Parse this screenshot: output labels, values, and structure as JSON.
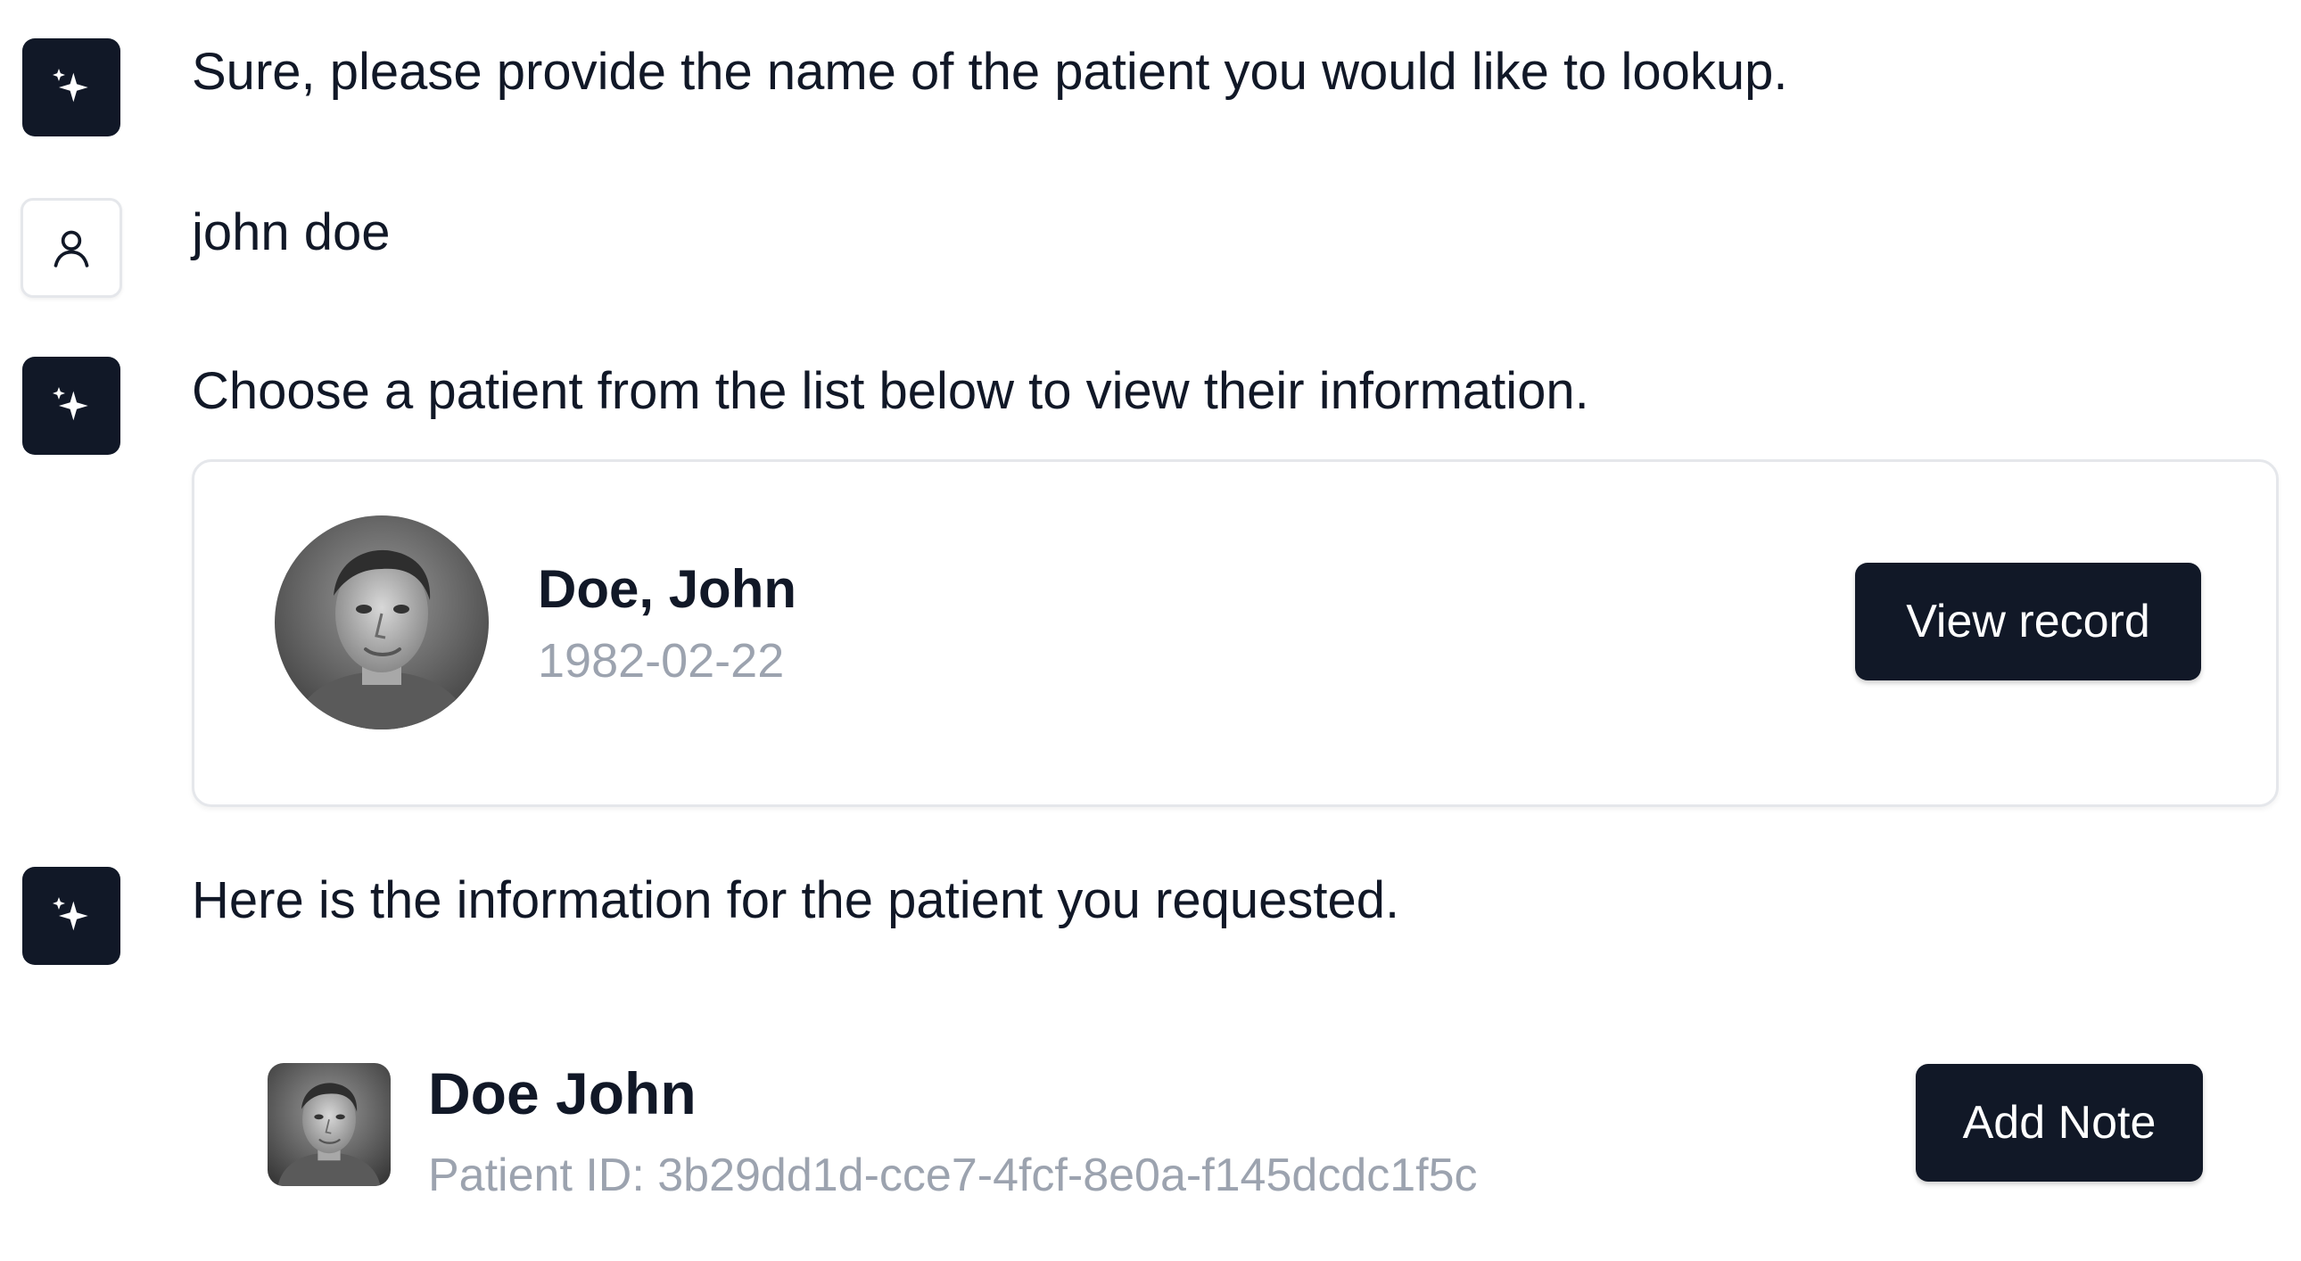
{
  "messages": [
    {
      "role": "assistant",
      "icon": "sparkles-icon",
      "text": "Sure, please provide the name of the patient you would like to lookup."
    },
    {
      "role": "user",
      "icon": "user-icon",
      "text": "john doe"
    },
    {
      "role": "assistant",
      "icon": "sparkles-icon",
      "text": "Choose a patient from the list below to view their information."
    },
    {
      "role": "assistant",
      "icon": "sparkles-icon",
      "text": "Here is the information for the patient you requested."
    }
  ],
  "patient_list": {
    "patients": [
      {
        "name": "Doe, John",
        "dob": "1982-02-22",
        "action_label": "View record"
      }
    ]
  },
  "patient_info": {
    "name": "Doe John",
    "patient_id": "Patient ID: 3b29dd1d-cce7-4fcf-8e0a-f145dcdc1f5c",
    "action_label": "Add Note"
  },
  "colors": {
    "primary": "#111827",
    "muted_text": "#9ca3af",
    "border": "#e5e7eb"
  }
}
